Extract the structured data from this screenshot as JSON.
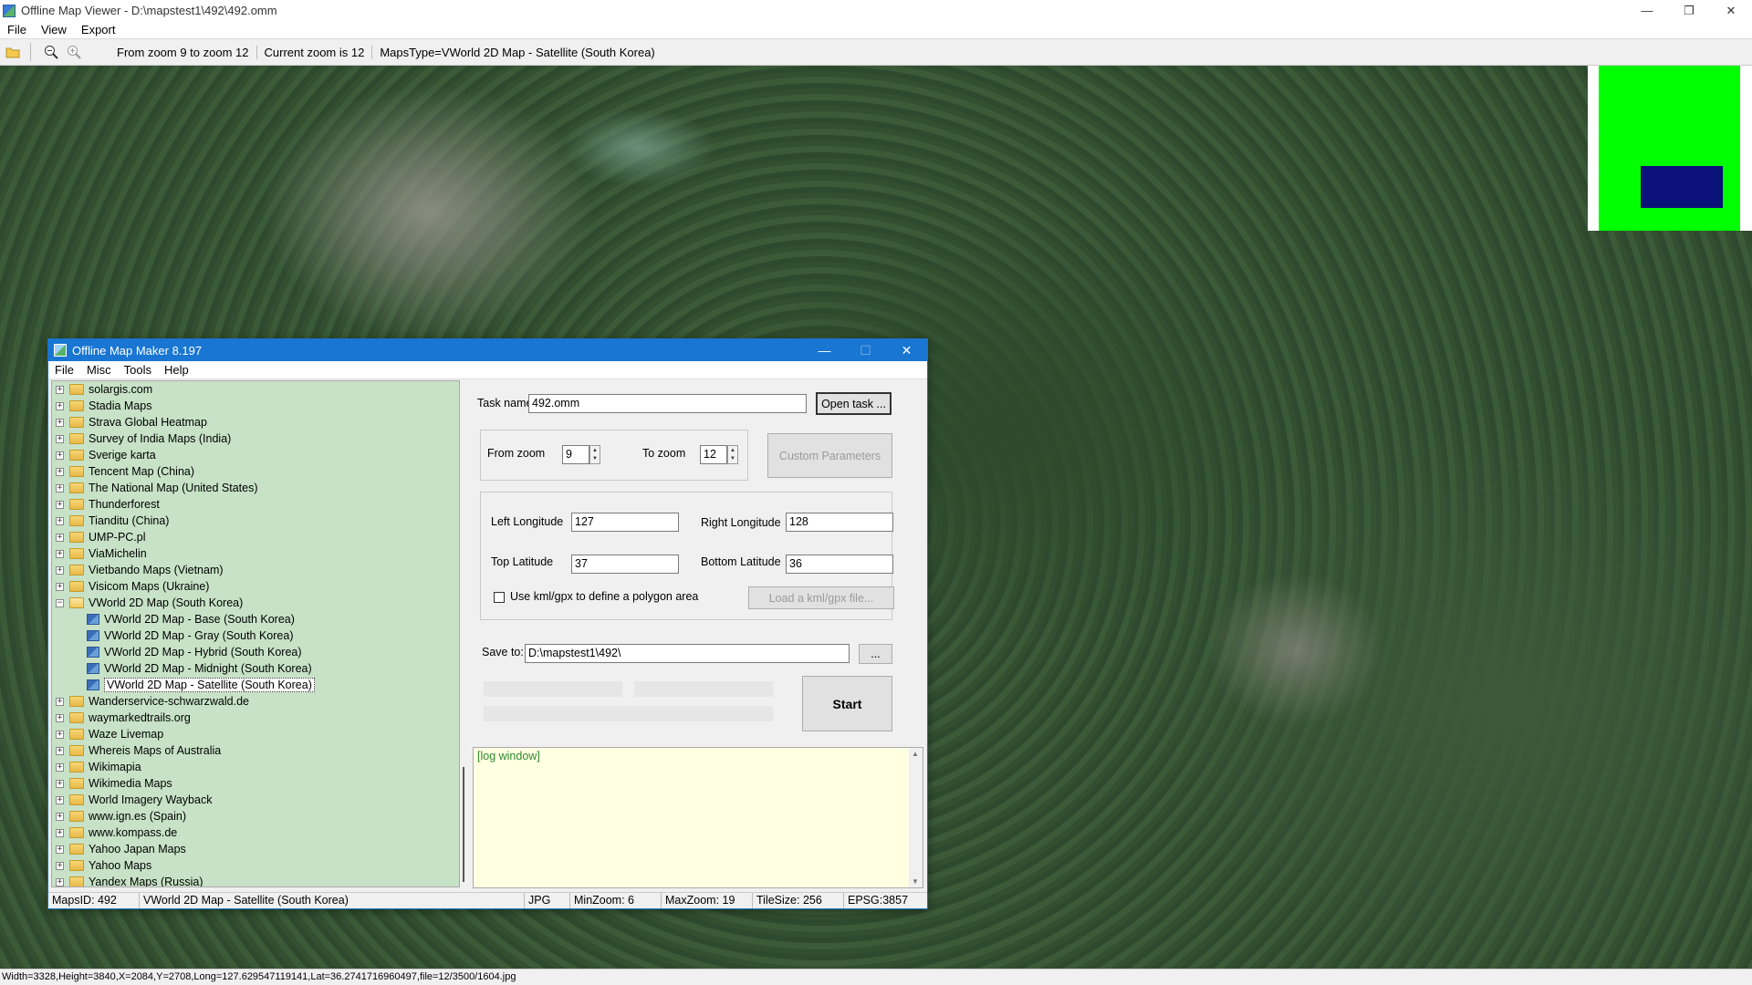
{
  "viewer": {
    "title": "Offline Map Viewer - D:\\mapstest1\\492\\492.omm",
    "menu": [
      "File",
      "View",
      "Export"
    ],
    "toolbar": {
      "zoom_range": "From zoom 9 to zoom 12",
      "current_zoom": "Current zoom is 12",
      "maps_type": "MapsType=VWorld 2D Map - Satellite (South Korea)"
    },
    "status": "Width=3328,Height=3840,X=2084,Y=2708,Long=127.629547119141,Lat=36.2741716960497,file=12/3500/1604.jpg"
  },
  "dialog": {
    "title": "Offline Map Maker 8.197",
    "menu": [
      "File",
      "Misc",
      "Tools",
      "Help"
    ],
    "tree": {
      "items": [
        "solargis.com",
        "Stadia Maps",
        "Strava Global Heatmap",
        "Survey of India Maps (India)",
        "Sverige karta",
        "Tencent Map (China)",
        "The National Map (United States)",
        "Thunderforest",
        "Tianditu (China)",
        "UMP-PC.pl",
        "ViaMichelin",
        "Vietbando Maps (Vietnam)",
        "Visicom Maps (Ukraine)",
        "VWorld 2D Map (South Korea)",
        "Wanderservice-schwarzwald.de",
        "waymarkedtrails.org",
        "Waze Livemap",
        "Whereis Maps of Australia",
        "Wikimapia",
        "Wikimedia Maps",
        "World Imagery Wayback",
        "www.ign.es (Spain)",
        "www.kompass.de",
        "Yahoo Japan Maps",
        "Yahoo Maps",
        "Yandex Maps (Russia)"
      ],
      "children": [
        "VWorld 2D Map - Base (South Korea)",
        "VWorld 2D Map - Gray (South Korea)",
        "VWorld 2D Map - Hybrid (South Korea)",
        "VWorld 2D Map - Midnight (South Korea)",
        "VWorld 2D Map - Satellite (South Korea)"
      ],
      "expanded_index": 13,
      "selected_child_index": 4
    },
    "form": {
      "task_name_label": "Task name",
      "task_name": "492.omm",
      "open_task": "Open task ...",
      "from_zoom_label": "From zoom",
      "from_zoom": "9",
      "to_zoom_label": "To zoom",
      "to_zoom": "12",
      "custom_parameters": "Custom Parameters",
      "left_lon_label": "Left Longitude",
      "left_lon": "127",
      "right_lon_label": "Right Longitude",
      "right_lon": "128",
      "top_lat_label": "Top Latitude",
      "top_lat": "37",
      "bottom_lat_label": "Bottom Latitude",
      "bottom_lat": "36",
      "kml_checkbox_label": "Use kml/gpx to define a polygon area",
      "load_kml": "Load a kml/gpx file...",
      "save_to_label": "Save to:",
      "save_to": "D:\\mapstest1\\492\\",
      "browse": "...",
      "start": "Start"
    },
    "log": "[log window]",
    "status": {
      "maps_id": "MapsID: 492",
      "map_name": "VWorld 2D Map - Satellite (South Korea)",
      "format": "JPG",
      "min_zoom": "MinZoom: 6",
      "max_zoom": "MaxZoom: 19",
      "tile_size": "TileSize: 256",
      "epsg": "EPSG:3857"
    }
  }
}
